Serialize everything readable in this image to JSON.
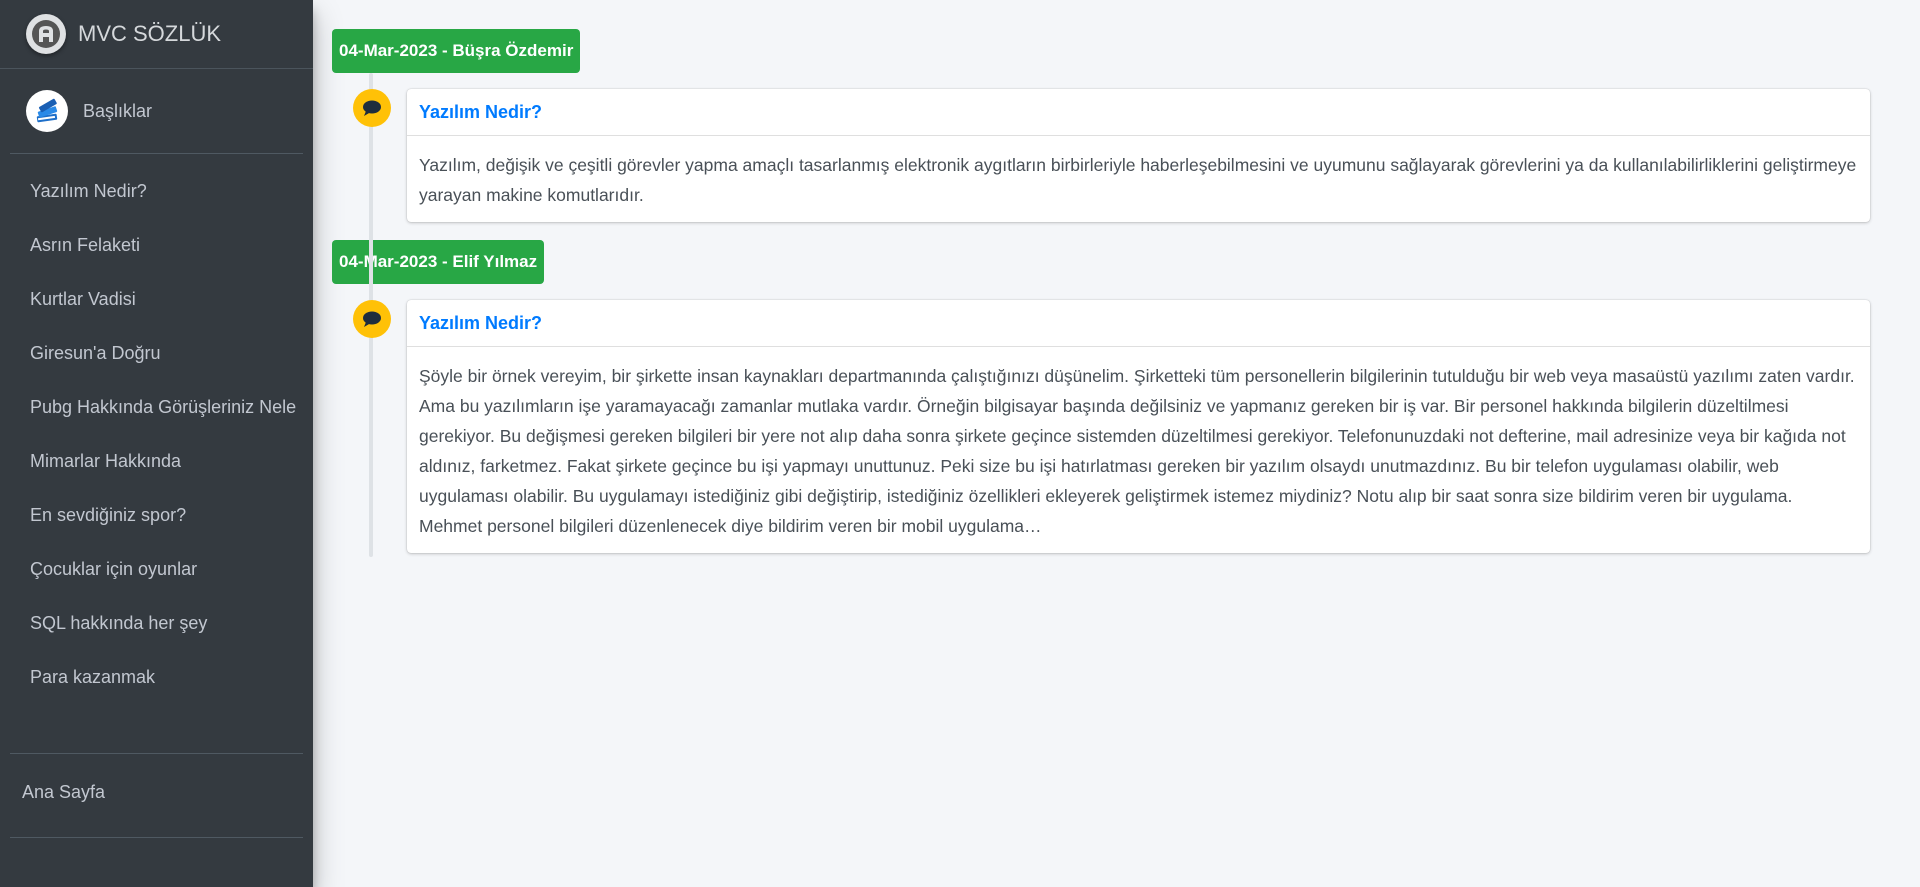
{
  "brand": {
    "title": "MVC SÖZLÜK",
    "icon": "letter-a-logo-icon"
  },
  "user_panel": {
    "label": "Başlıklar",
    "icon": "books-icon"
  },
  "sidebar": {
    "items": [
      {
        "label": "Yazılım Nedir?"
      },
      {
        "label": "Asrın Felaketi"
      },
      {
        "label": "Kurtlar Vadisi"
      },
      {
        "label": "Giresun'a Doğru"
      },
      {
        "label": "Pubg Hakkında Görüşleriniz Nele"
      },
      {
        "label": "Mimarlar Hakkında"
      },
      {
        "label": "En sevdiğiniz spor?"
      },
      {
        "label": "Çocuklar için oyunlar"
      },
      {
        "label": "SQL hakkında her şey"
      },
      {
        "label": "Para kazanmak"
      }
    ],
    "home_link": "Ana Sayfa"
  },
  "timeline": [
    {
      "time_label": "04-Mar-2023 - Büşra Özdemir",
      "title": "Yazılım Nedir?",
      "body": "Yazılım, değişik ve çeşitli görevler yapma amaçlı tasarlanmış elektronik aygıtların birbirleriyle haberleşebilmesini ve uyumunu sağlayarak görevlerini ya da kullanılabilirliklerini geliştirmeye yarayan makine komutlarıdır."
    },
    {
      "time_label": "04-Mar-2023 - Elif Yılmaz",
      "title": "Yazılım Nedir?",
      "body": "Şöyle bir örnek vereyim, bir şirkette insan kaynakları departmanında çalıştığınızı düşünelim. Şirketteki tüm personellerin bilgilerinin tutulduğu bir web veya masaüstü yazılımı zaten vardır. Ama bu yazılımların işe yaramayacağı zamanlar mutlaka vardır. Örneğin bilgisayar başında değilsiniz ve yapmanız gereken bir iş var. Bir personel hakkında bilgilerin düzeltilmesi gerekiyor. Bu değişmesi gereken bilgileri bir yere not alıp daha sonra şirkete geçince sistemden düzeltilmesi gerekiyor. Telefonunuzdaki not defterine, mail adresinize veya bir kağıda not aldınız, farketmez. Fakat şirkete geçince bu işi yapmayı unuttunuz. Peki size bu işi hatırlatması gereken bir yazılım olsaydı unutmazdınız. Bu bir telefon uygulaması olabilir, web uygulaması olabilir. Bu uygulamayı istediğiniz gibi değiştirip, istediğiniz özellikleri ekleyerek geliştirmek istemez miydiniz? Notu alıp bir saat sonra size bildirim veren bir uygulama. Mehmet personel bilgileri düzenlenecek diye bildirim veren bir mobil uygulama…"
    }
  ],
  "colors": {
    "sidebar_bg": "#343a40",
    "time_label_bg": "#28a745",
    "icon_bg": "#ffc107",
    "link": "#007bff",
    "page_bg": "#f4f6f9"
  },
  "icons": {
    "timeline_item": "comment-icon"
  }
}
